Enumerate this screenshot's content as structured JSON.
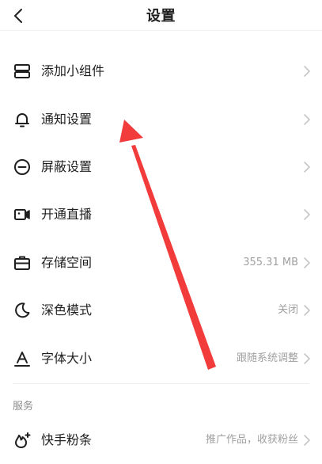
{
  "header": {
    "title": "设置",
    "back_icon": "chevron-left-icon"
  },
  "settings": {
    "items": [
      {
        "label": "添加小组件",
        "icon": "widget-icon",
        "value": ""
      },
      {
        "label": "通知设置",
        "icon": "bell-icon",
        "value": ""
      },
      {
        "label": "屏蔽设置",
        "icon": "block-icon",
        "value": ""
      },
      {
        "label": "开通直播",
        "icon": "video-icon",
        "value": ""
      },
      {
        "label": "存储空间",
        "icon": "storage-icon",
        "value": "355.31 MB"
      },
      {
        "label": "深色模式",
        "icon": "moon-icon",
        "value": "关闭"
      },
      {
        "label": "字体大小",
        "icon": "font-size-icon",
        "value": "跟随系统调整"
      }
    ]
  },
  "services": {
    "title": "服务",
    "items": [
      {
        "label": "快手粉条",
        "icon": "boost-icon",
        "value": "推广作品，收获粉丝"
      }
    ]
  },
  "annotation": {
    "arrow_color": "#f23b3b"
  },
  "colors": {
    "text": "#1f1f1f",
    "secondary_text": "#a0a0a0",
    "chevron": "#c7c7c7"
  }
}
